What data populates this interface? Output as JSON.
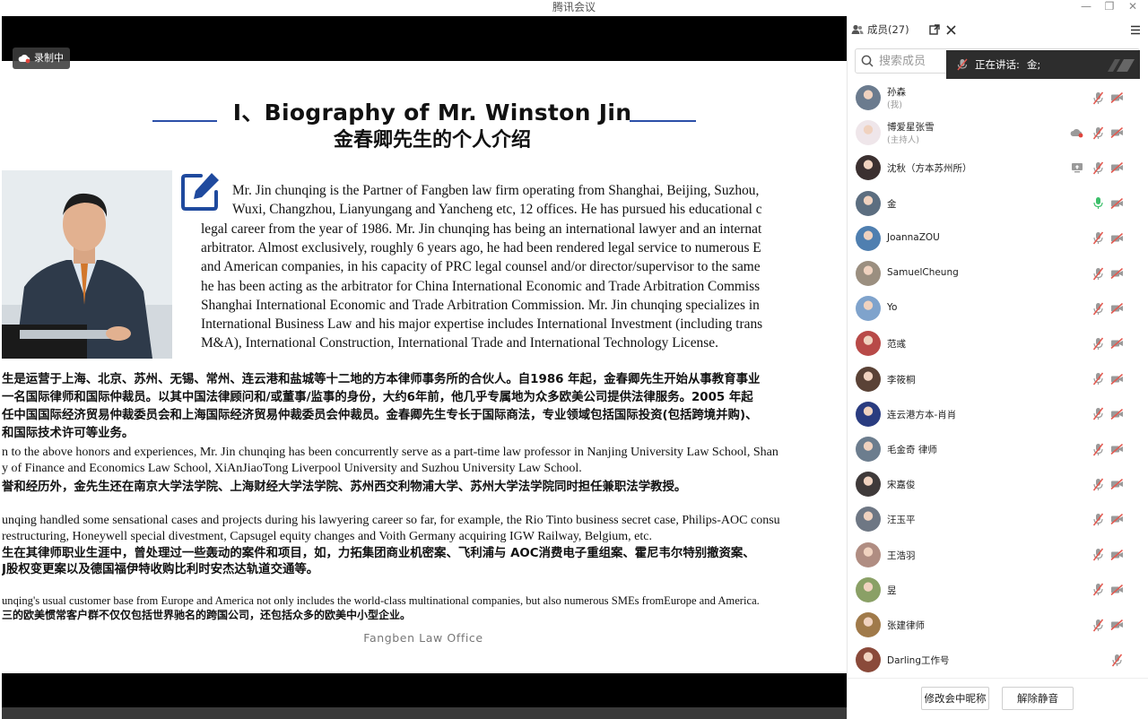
{
  "window": {
    "title": "腾讯会议",
    "minimize": "—",
    "restore": "❐",
    "close": "✕"
  },
  "recording": {
    "label": "录制中"
  },
  "slide": {
    "title_en": "Ⅰ、Biography of Mr. Winston Jin",
    "title_cn": "金春卿先生的个人介绍",
    "para1": [
      "Mr. Jin chunqing is the Partner of Fangben law firm operating from Shanghai, Beijing, Suzhou,",
      "Wuxi, Changzhou, Lianyungang and Yancheng etc, 12 offices. He has pursued his educational c",
      "legal career from the year of 1986. Mr. Jin chunqing has being an international lawyer and an internat",
      "arbitrator. Almost exclusively, roughly 6 years ago, he had been rendered legal service to numerous E",
      "and American companies, in his capacity of PRC legal counsel and/or director/supervisor to the same",
      "he has been acting as the arbitrator for China International Economic and Trade Arbitration Commiss",
      "Shanghai International Economic and Trade Arbitration Commission. Mr. Jin chunqing specializes in",
      "International Business Law and his major expertise includes International Investment (including trans",
      "M&A), International Construction, International Trade and International Technology License."
    ],
    "para1_cn": [
      "生是运营于上海、北京、苏州、无锡、常州、连云港和盐城等十二地的方本律师事务所的合伙人。自1986 年起，金春卿先生开始从事教育事业",
      "一名国际律师和国际仲裁员。以其中国法律顾问和/或董事/监事的身份，大约6年前，他几乎专属地为众多欧美公司提供法律服务。2005 年起",
      "任中国国际经济贸易仲裁委员会和上海国际经济贸易仲裁委员会仲裁员。金春卿先生专长于国际商法，专业领域包括国际投资(包括跨境并购)、",
      "和国际技术许可等业务。"
    ],
    "para2_en": [
      "n to the above honors and experiences, Mr. Jin chunqing has been concurrently serve as a part-time law professor in Nanjing University Law School, Shan",
      "y of Finance and Economics Law School, XiAnJiaoTong Liverpool University and Suzhou University Law School."
    ],
    "para2_cn": "誉和经历外，金先生还在南京大学法学院、上海财经大学法学院、苏州西交利物浦大学、苏州大学法学院同时担任兼职法学教授。",
    "para3_en": [
      "unqing handled some sensational cases and projects during his lawyering career so far, for example, the Rio Tinto business secret case, Philips-AOC consu",
      " restructuring, Honeywell special divestment, Capsugel equity changes and Voith Germany acquiring IGW Railway, Belgium, etc."
    ],
    "para3_cn": [
      "生在其律师职业生涯中，曾处理过一些轰动的案件和项目，如，力拓集团商业机密案、飞利浦与 AOC消费电子重组案、霍尼韦尔特别撤资案、",
      "J股权变更案以及德国福伊特收购比利时安杰达轨道交通等。"
    ],
    "para4_en": "unqing's usual customer base from Europe and America not only includes the world-class multinational companies, but also numerous SMEs fromEurope and America.",
    "para4_cn": "三的欧美惯常客户群不仅仅包括世界驰名的跨国公司，还包括众多的欧美中小型企业。",
    "footer": "Fangben Law Office"
  },
  "panel": {
    "tab_label": "成员(27)",
    "search_placeholder": "搜索成员",
    "speaking_label": "正在讲话:",
    "speaking_name": "金;",
    "members": [
      {
        "name": "孙森",
        "sub": "(我)",
        "extra": "",
        "mic": "muted",
        "cam": "off",
        "avatar": "#6b7b8e"
      },
      {
        "name": "博爱星张雪",
        "sub": "(主持人)",
        "extra": "cloud-record",
        "mic": "muted",
        "cam": "off",
        "avatar": "#efe6ea"
      },
      {
        "name": "沈秋（方本苏州所）",
        "sub": "",
        "extra": "screen-share",
        "mic": "muted",
        "cam": "off",
        "avatar": "#3b3030"
      },
      {
        "name": "金",
        "sub": "",
        "extra": "",
        "mic": "on",
        "cam": "off",
        "avatar": "#5c6e80"
      },
      {
        "name": "JoannaZOU",
        "sub": "",
        "extra": "",
        "mic": "muted",
        "cam": "off",
        "avatar": "#4f7fb0"
      },
      {
        "name": "SamuelCheung",
        "sub": "",
        "extra": "",
        "mic": "muted",
        "cam": "off",
        "avatar": "#9b8f80"
      },
      {
        "name": "Yo",
        "sub": "",
        "extra": "",
        "mic": "muted",
        "cam": "off",
        "avatar": "#7fa3cc"
      },
      {
        "name": "范彧",
        "sub": "",
        "extra": "",
        "mic": "muted",
        "cam": "off",
        "avatar": "#b84a48"
      },
      {
        "name": "李筱桐",
        "sub": "",
        "extra": "",
        "mic": "muted",
        "cam": "off",
        "avatar": "#5a4236"
      },
      {
        "name": "连云港方本-肖肖",
        "sub": "",
        "extra": "",
        "mic": "muted",
        "cam": "off",
        "avatar": "#2a3c80"
      },
      {
        "name": "毛金奇 律师",
        "sub": "",
        "extra": "",
        "mic": "muted",
        "cam": "off",
        "avatar": "#6c7d8e"
      },
      {
        "name": "宋嘉俊",
        "sub": "",
        "extra": "",
        "mic": "muted",
        "cam": "off",
        "avatar": "#3f3a3a"
      },
      {
        "name": "汪玉平",
        "sub": "",
        "extra": "",
        "mic": "muted",
        "cam": "off",
        "avatar": "#6e7784"
      },
      {
        "name": "王浩羽",
        "sub": "",
        "extra": "",
        "mic": "muted",
        "cam": "off",
        "avatar": "#b08d82"
      },
      {
        "name": "昱",
        "sub": "",
        "extra": "",
        "mic": "muted",
        "cam": "off",
        "avatar": "#8aa066"
      },
      {
        "name": "张建律师",
        "sub": "",
        "extra": "",
        "mic": "muted",
        "cam": "off",
        "avatar": "#a07a4a"
      },
      {
        "name": "Darling工作号",
        "sub": "",
        "extra": "",
        "mic": "muted",
        "cam": "none",
        "avatar": "#8a4a3a"
      }
    ],
    "rename_button": "修改会中昵称",
    "unmute_button": "解除静音"
  },
  "colors": {
    "accent_blue": "#2b4fa8",
    "mic_muted": "#e4584f",
    "mic_on": "#3cbf6a",
    "speaking_bg": "#2d2d2d"
  }
}
